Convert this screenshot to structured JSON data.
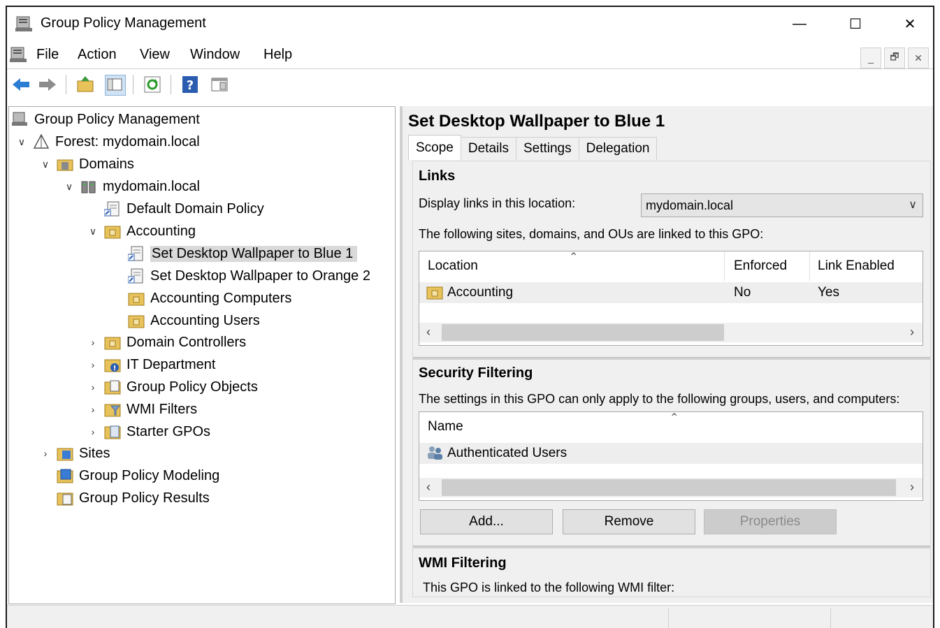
{
  "window": {
    "title": "Group Policy Management",
    "minimize_glyph": "—",
    "maximize_glyph": "☐",
    "close_glyph": "✕"
  },
  "menu": {
    "items": [
      "File",
      "Action",
      "View",
      "Window",
      "Help"
    ],
    "mdi": [
      "_",
      "🗗",
      "✕"
    ]
  },
  "toolbar": {
    "icons": [
      "back-arrow-icon",
      "forward-arrow-icon",
      "up-folder-icon",
      "show-hide-tree-icon",
      "refresh-icon",
      "help-icon",
      "properties-pane-icon"
    ]
  },
  "tree": {
    "items": [
      {
        "label": "Group Policy Management",
        "expander": ""
      },
      {
        "label": "Forest: mydomain.local",
        "expander": "∨"
      },
      {
        "label": "Domains",
        "expander": "∨"
      },
      {
        "label": "mydomain.local",
        "expander": "∨"
      },
      {
        "label": "Default Domain Policy",
        "expander": ""
      },
      {
        "label": "Accounting",
        "expander": "∨"
      },
      {
        "label": "Set Desktop Wallpaper to Blue 1",
        "expander": ""
      },
      {
        "label": "Set Desktop Wallpaper to Orange 2",
        "expander": ""
      },
      {
        "label": "Accounting Computers",
        "expander": ""
      },
      {
        "label": "Accounting Users",
        "expander": ""
      },
      {
        "label": "Domain Controllers",
        "expander": "›"
      },
      {
        "label": "IT Department",
        "expander": "›"
      },
      {
        "label": "Group Policy Objects",
        "expander": "›"
      },
      {
        "label": "WMI Filters",
        "expander": "›"
      },
      {
        "label": "Starter GPOs",
        "expander": "›"
      },
      {
        "label": "Sites",
        "expander": "›"
      },
      {
        "label": "Group Policy Modeling",
        "expander": ""
      },
      {
        "label": "Group Policy Results",
        "expander": ""
      }
    ]
  },
  "gpo": {
    "title": "Set Desktop Wallpaper to Blue 1",
    "tabs": [
      "Scope",
      "Details",
      "Settings",
      "Delegation"
    ],
    "links": {
      "heading": "Links",
      "location_label": "Display links in this location:",
      "location_value": "mydomain.local",
      "description": "The following sites, domains, and OUs are linked to this GPO:",
      "columns": [
        "Location",
        "Enforced",
        "Link Enabled"
      ],
      "rows": [
        {
          "location": "Accounting",
          "enforced": "No",
          "link_enabled": "Yes"
        }
      ]
    },
    "security": {
      "heading": "Security Filtering",
      "description": "The settings in this GPO can only apply to the following groups, users, and computers:",
      "columns": [
        "Name"
      ],
      "rows": [
        {
          "name": "Authenticated Users"
        }
      ],
      "buttons": {
        "add": "Add...",
        "remove": "Remove",
        "properties": "Properties"
      }
    },
    "wmi": {
      "heading": "WMI Filtering",
      "description": "This GPO is linked to the following WMI filter:"
    }
  },
  "colors": {
    "selection": "#d9d9d9",
    "panel_bg": "#f0f0f0",
    "folder": "#e8c25a"
  }
}
